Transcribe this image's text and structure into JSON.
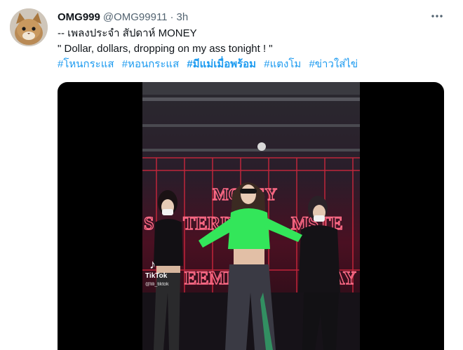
{
  "tweet": {
    "display_name": "OMG999",
    "handle": "@OMG99911",
    "dot": "·",
    "time": "3h",
    "more_icon": "more-horizontal-icon",
    "lines": [
      "-- เพลงประจำ สัปดาห์  MONEY",
      "\" Dollar, dollars, dropping on my ass tonight ! \""
    ],
    "hashtags": [
      "#โหนกระแส",
      "#หอนกระแส",
      "#มีแม่เมื่อพร้อม",
      "#แตงโม",
      "#ข่าวใส่ไข่"
    ]
  },
  "video": {
    "sign_top": "MONEY",
    "sign_left": "S",
    "sign_mid": "TERRI",
    "sign_right": "MSTE",
    "sign_bottom": "EEMENT",
    "sign_bottom2": "SWAY",
    "tiktok_label": "TikTok",
    "tiktok_handle": "@lili_tiktok"
  },
  "colors": {
    "link": "#1d9bf0",
    "muted": "#536471",
    "text": "#0f1419",
    "neon_sign": "#ff4a6a",
    "green_top": "#33e65a"
  }
}
